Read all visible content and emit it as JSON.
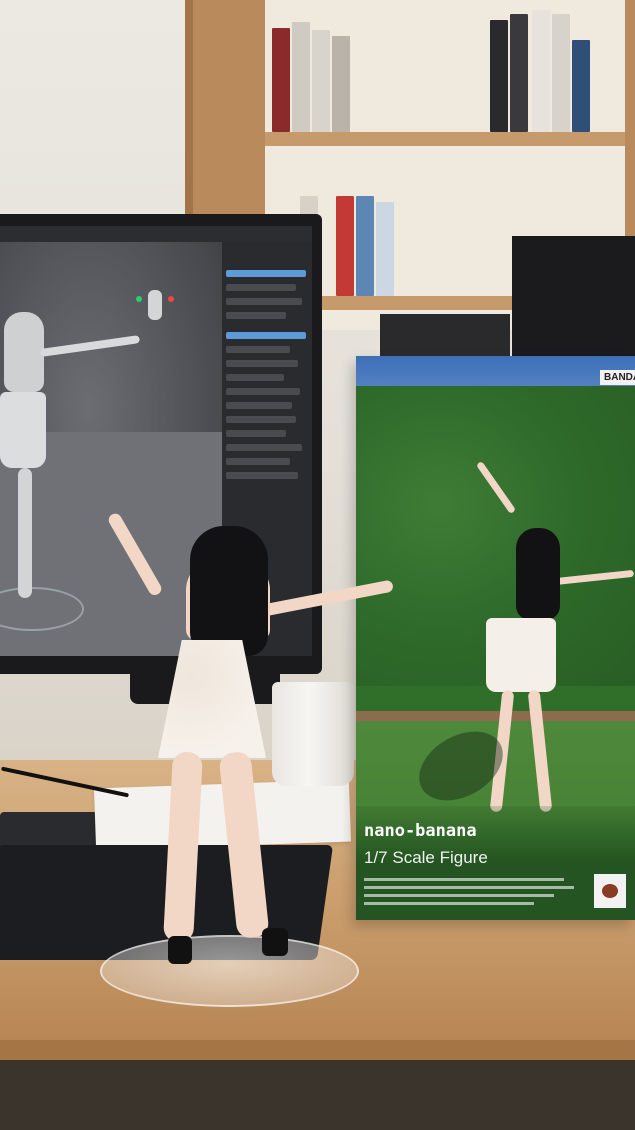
{
  "box": {
    "brand": "BANDAI",
    "title": "nano-banana",
    "subtitle": "1/7 Scale Figure"
  },
  "colors": {
    "desk": "#c99c6b",
    "box_green": "#2f6f2a",
    "sky": "#3d6fb7",
    "screen": "#3b3c40"
  }
}
